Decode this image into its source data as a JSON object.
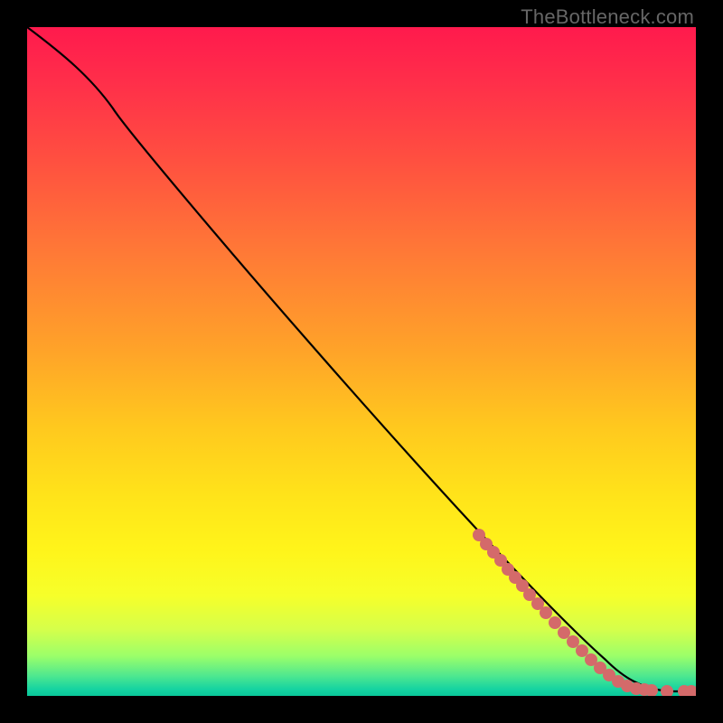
{
  "watermark": "TheBottleneck.com",
  "chart_data": {
    "type": "line",
    "title": "",
    "xlabel": "",
    "ylabel": "",
    "xlim": [
      0,
      100
    ],
    "ylim": [
      0,
      100
    ],
    "series": [
      {
        "name": "curve",
        "x": [
          0,
          5,
          10,
          13,
          20,
          30,
          40,
          50,
          60,
          70,
          80,
          86,
          90,
          94,
          97,
          100
        ],
        "y": [
          100,
          97,
          93,
          88,
          79,
          67,
          55,
          44,
          33,
          22,
          12,
          6,
          3,
          1,
          0.7,
          0.7
        ]
      }
    ],
    "scatter": {
      "name": "marked-points",
      "x": [
        68,
        69,
        70,
        71,
        72,
        73,
        74,
        75,
        76,
        77.5,
        79,
        80,
        81.5,
        83,
        84.5,
        86,
        87,
        88.5,
        90,
        91,
        92,
        93.5,
        95.5,
        98,
        99.5
      ],
      "y": [
        24,
        23,
        21.5,
        20.5,
        19,
        18,
        16.5,
        15.5,
        14,
        12.5,
        11,
        9.5,
        8,
        7,
        5.5,
        4.5,
        3.5,
        2.5,
        1.5,
        1,
        0.9,
        0.8,
        0.7,
        0.7,
        0.7
      ]
    },
    "background_gradient": {
      "top": "#ff1a4d",
      "mid": "#ffe31a",
      "bottom": "#0ac79a"
    }
  }
}
